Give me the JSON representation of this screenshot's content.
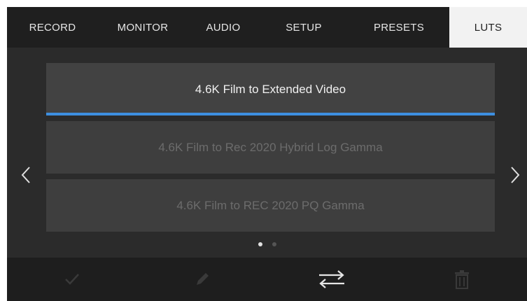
{
  "tabs": [
    {
      "label": "RECORD",
      "active": false
    },
    {
      "label": "MONITOR",
      "active": false
    },
    {
      "label": "AUDIO",
      "active": false
    },
    {
      "label": "SETUP",
      "active": false
    },
    {
      "label": "PRESETS",
      "active": false
    },
    {
      "label": "LUTS",
      "active": true
    }
  ],
  "luts": {
    "items": [
      {
        "label": "4.6K Film to Extended Video",
        "selected": true
      },
      {
        "label": "4.6K Film to Rec 2020 Hybrid Log Gamma",
        "selected": false
      },
      {
        "label": "4.6K Film to REC 2020 PQ Gamma",
        "selected": false
      }
    ],
    "page": 1,
    "page_count": 2
  },
  "toolbar": {
    "icons": [
      "checkmark-icon",
      "pencil-icon",
      "transfer-arrows-icon",
      "trash-icon"
    ]
  },
  "colors": {
    "accent": "#3d8fe0",
    "background": "#2b2b2b",
    "tab_active_bg": "#f2f2f2"
  }
}
